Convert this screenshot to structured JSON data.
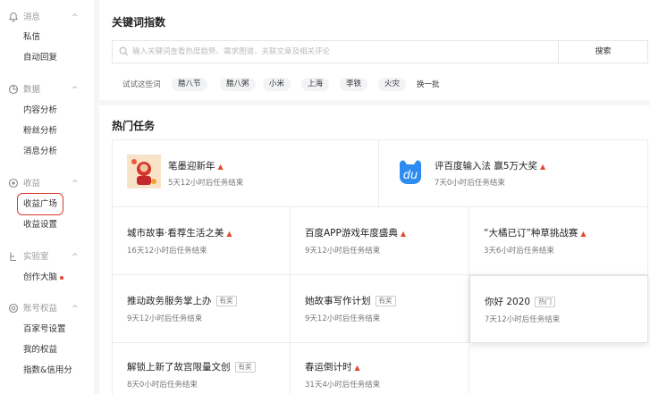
{
  "sidebar": {
    "groups": [
      {
        "label": "消息",
        "icon": "bell-icon",
        "items": [
          "私信",
          "自动回复"
        ]
      },
      {
        "label": "数据",
        "icon": "chart-icon",
        "items": [
          "内容分析",
          "粉丝分析",
          "消息分析"
        ]
      },
      {
        "label": "收益",
        "icon": "coin-icon",
        "items": [
          "收益广场",
          "收益设置"
        ]
      },
      {
        "label": "实验室",
        "icon": "lab-icon",
        "items": [
          "创作大脑"
        ]
      },
      {
        "label": "账号权益",
        "icon": "badge-icon",
        "items": [
          "百家号设置",
          "我的权益",
          "指数&信用分"
        ]
      }
    ],
    "collapse_glyph": "^",
    "new_dot_color": "#e8432e",
    "highlight_color": "#d93a2b"
  },
  "keyword": {
    "title": "关键词指数",
    "placeholder": "输入关键词查看热度趋势、需求图谱、关联文章及相关评论",
    "search_label": "搜索",
    "try_label": "试试这些词",
    "tags": [
      "腊八节",
      "腊八粥",
      "小米",
      "上海",
      "李铁",
      "火灾"
    ],
    "swap_label": "换一批"
  },
  "tasks": {
    "title": "热门任务",
    "featured": [
      {
        "title": "笔墨迎新年",
        "sub": "5天12小时后任务结束",
        "hot": true
      },
      {
        "title": "评百度输入法 赢5万大奖",
        "sub": "7天0小时后任务结束",
        "hot": true,
        "logo": "du"
      }
    ],
    "grid": [
      {
        "title": "城市故事·看荐生活之美",
        "sub": "16天12小时后任务结束",
        "hot": true
      },
      {
        "title": "百度APP游戏年度盛典",
        "sub": "9天12小时后任务结束",
        "hot": true
      },
      {
        "title": "“大橘已订”种草挑战赛",
        "sub": "3天6小时后任务结束",
        "hot": true
      },
      {
        "title": "推动政务服务掌上办",
        "sub": "9天12小时后任务结束",
        "badge": "有奖"
      },
      {
        "title": "她故事写作计划",
        "sub": "9天12小时后任务结束",
        "badge": "有奖"
      },
      {
        "title": "你好 2020",
        "sub": "7天12小时后任务结束",
        "badge": "热门"
      },
      {
        "title": "解锁上新了故宫限量文创",
        "sub": "8天0小时后任务结束",
        "badge": "有奖"
      },
      {
        "title": "春运倒计时",
        "sub": "31天4小时后任务结束",
        "hot": true
      }
    ]
  },
  "colors": {
    "accent": "#e24a2b",
    "brand_blue": "#2d8cf0"
  }
}
